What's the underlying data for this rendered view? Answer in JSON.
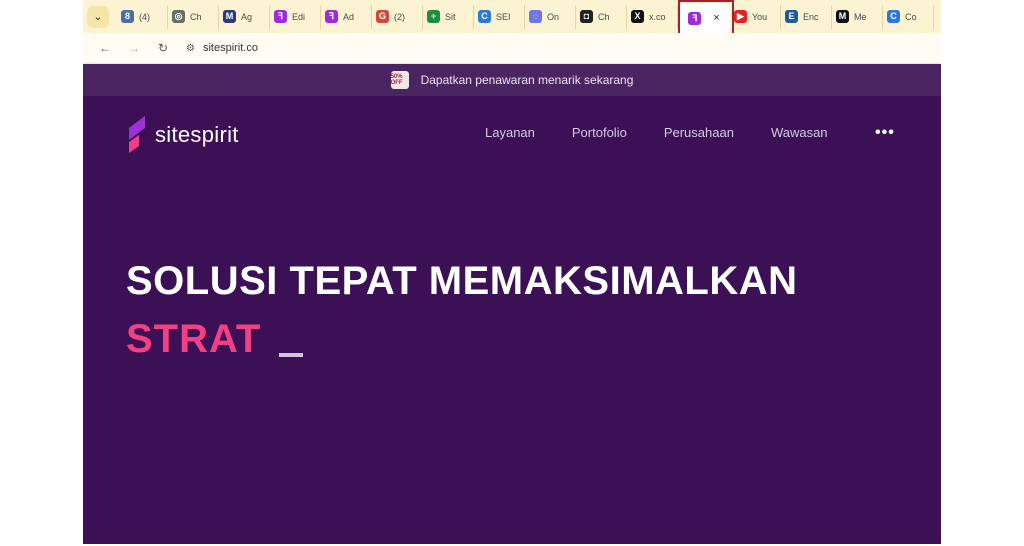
{
  "tabs": [
    {
      "icon": "bookmark-8-icon",
      "glyph": "8",
      "color": "#4a6fa5",
      "label": "(4)"
    },
    {
      "icon": "chatgpt-icon",
      "glyph": "◎",
      "color": "#6a6a6a",
      "label": "Ch"
    },
    {
      "icon": "letter-m-icon",
      "glyph": "M",
      "color": "#2b3a78",
      "label": "Ag"
    },
    {
      "icon": "sitespirit-icon",
      "glyph": "ꟻ",
      "color": "#a02ad8",
      "label": "Edi"
    },
    {
      "icon": "sitespirit-icon",
      "glyph": "ꟻ",
      "color": "#a02ad8",
      "label": "Ad"
    },
    {
      "icon": "google-circle-icon",
      "glyph": "G",
      "color": "#d6473b",
      "label": "(2)"
    },
    {
      "icon": "sheets-plus-icon",
      "glyph": "+",
      "color": "#1e8e3e",
      "label": "Sit"
    },
    {
      "icon": "seo-c-icon",
      "glyph": "C",
      "color": "#2c7ad6",
      "label": "SEI"
    },
    {
      "icon": "on-circle-icon",
      "glyph": "◌",
      "color": "#6f74e6",
      "label": "On"
    },
    {
      "icon": "square-brand-icon",
      "glyph": "◘",
      "color": "#222222",
      "label": "Ch"
    },
    {
      "icon": "x-icon",
      "glyph": "X",
      "color": "#111111",
      "label": "x.co"
    },
    {
      "icon": "sitespirit-icon",
      "glyph": "ꟻ",
      "color": "#a02ad8",
      "label": "",
      "active": true
    },
    {
      "icon": "youtube-icon",
      "glyph": "▶",
      "color": "#e32222",
      "label": "You"
    },
    {
      "icon": "excel-icon",
      "glyph": "E",
      "color": "#1f5c99",
      "label": "Enc"
    },
    {
      "icon": "medium-icon",
      "glyph": "M",
      "color": "#111111",
      "label": "Me"
    },
    {
      "icon": "c-circle-icon",
      "glyph": "C",
      "color": "#2c7ad6",
      "label": "Co"
    }
  ],
  "active_tab_close": "×",
  "address": {
    "url": "sitespirit.co"
  },
  "promo": {
    "badge": "50% OFF",
    "text": "Dapatkan penawaran menarik sekarang"
  },
  "brand": {
    "name": "sitespirit",
    "color_top": "#9b32d6",
    "color_bottom": "#f33f83"
  },
  "nav": {
    "items": [
      "Layanan",
      "Portofolio",
      "Perusahaan",
      "Wawasan"
    ],
    "more": "•••"
  },
  "hero": {
    "headline": "SOLUSI TEPAT MEMAKSIMALKAN",
    "typed": "STRAT"
  }
}
